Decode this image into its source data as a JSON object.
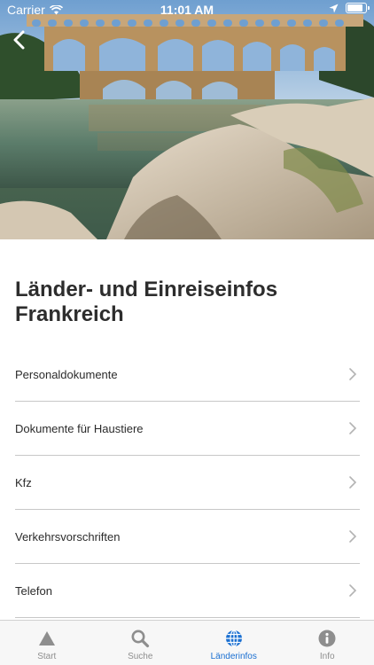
{
  "status_bar": {
    "carrier": "Carrier",
    "time": "11:01 AM",
    "battery_level": 0.9
  },
  "header": {
    "back_icon": "chevron-left-icon",
    "hero_image": "pont-du-gard-aqueduct-photo"
  },
  "page": {
    "title": "Länder- und Einreiseinfos Frankreich"
  },
  "list": {
    "items": [
      {
        "label": "Personaldokumente"
      },
      {
        "label": "Dokumente für Haustiere"
      },
      {
        "label": "Kfz"
      },
      {
        "label": "Verkehrsvorschriften"
      },
      {
        "label": "Telefon"
      }
    ]
  },
  "tabbar": {
    "tabs": [
      {
        "label": "Start",
        "icon": "triangle-icon",
        "active": false
      },
      {
        "label": "Suche",
        "icon": "search-icon",
        "active": false
      },
      {
        "label": "Länderinfos",
        "icon": "globe-icon",
        "active": true
      },
      {
        "label": "Info",
        "icon": "info-icon",
        "active": false
      }
    ]
  },
  "colors": {
    "accent": "#1a6fd1",
    "inactive": "#8e8e8e",
    "separator": "#c8c8c8"
  }
}
